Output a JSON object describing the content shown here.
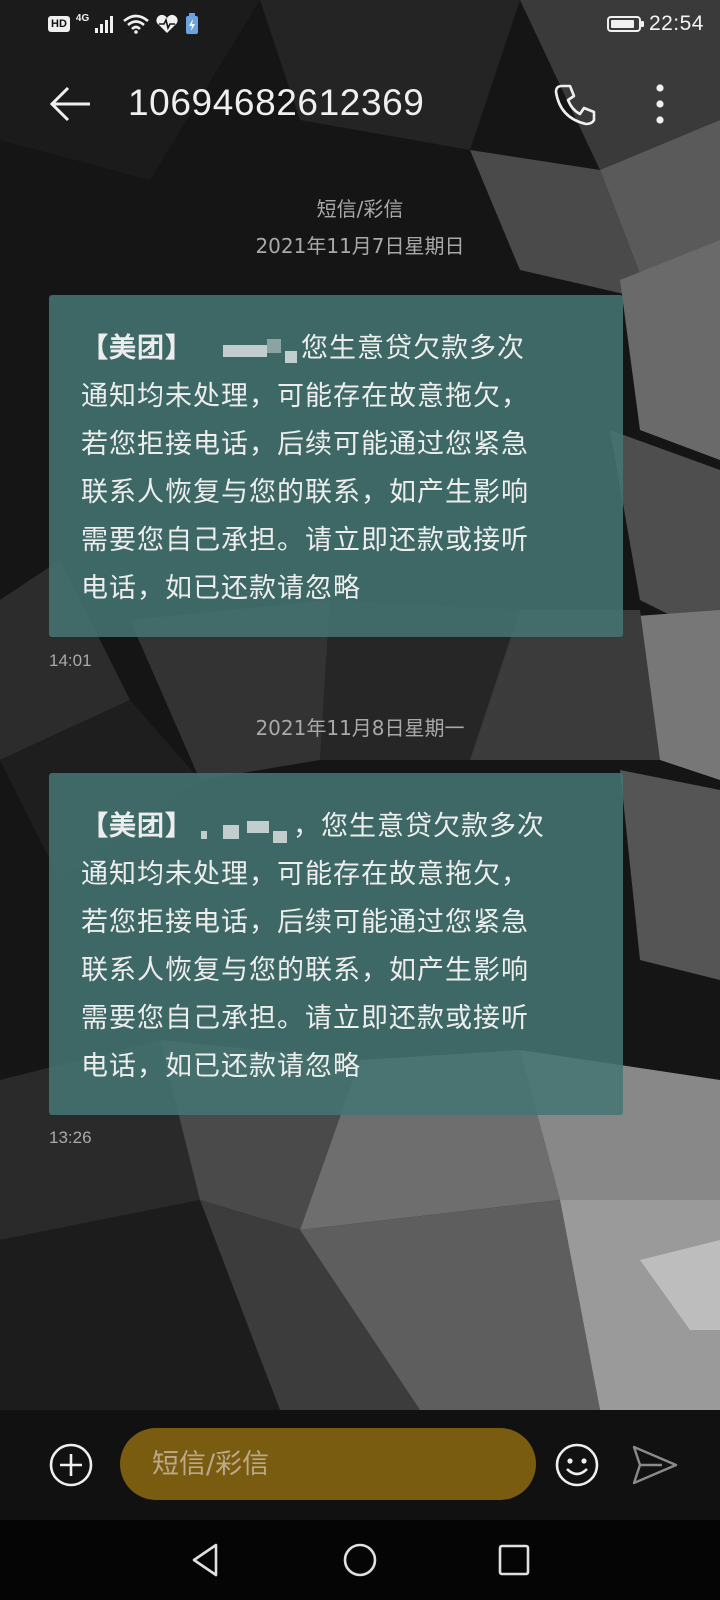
{
  "status_bar": {
    "hd_label": "HD",
    "network_label": "4G",
    "time": "22:54",
    "battery_level": 0.9
  },
  "header": {
    "contact": "10694682612369",
    "back_icon": "arrow-left-icon",
    "call_icon": "phone-icon",
    "more_icon": "more-vertical-icon"
  },
  "conversation": {
    "message_type_label": "短信/彩信",
    "groups": [
      {
        "date": "2021年11月7日星期日",
        "message": {
          "prefix": "【美团】",
          "text": "您生意贷欠款多次\n通知均未处理，可能存在故意拖欠，\n若您拒接电话，后续可能通过您紧急\n联系人恢复与您的联系，如产生影响\n需要您自己承担。请立即还款或接听\n电话，如已还款请忽略",
          "time": "14:01"
        }
      },
      {
        "date": "2021年11月8日星期一",
        "message": {
          "prefix": "【美团】",
          "text": "，您生意贷欠款多次\n通知均未处理，可能存在故意拖欠，\n若您拒接电话，后续可能通过您紧急\n联系人恢复与您的联系，如产生影响\n需要您自己承担。请立即还款或接听\n电话，如已还款请忽略",
          "time": "13:26"
        }
      }
    ]
  },
  "composer": {
    "placeholder": "短信/彩信",
    "add_icon": "plus-circle-icon",
    "emoji_icon": "smiley-icon",
    "send_icon": "send-icon"
  },
  "nav": {
    "back_icon": "triangle-back-icon",
    "home_icon": "circle-home-icon",
    "recent_icon": "square-recents-icon"
  },
  "colors": {
    "bubble": "#437673",
    "input_pill": "#7a5c10",
    "secondary_text": "#a9a9a9"
  }
}
